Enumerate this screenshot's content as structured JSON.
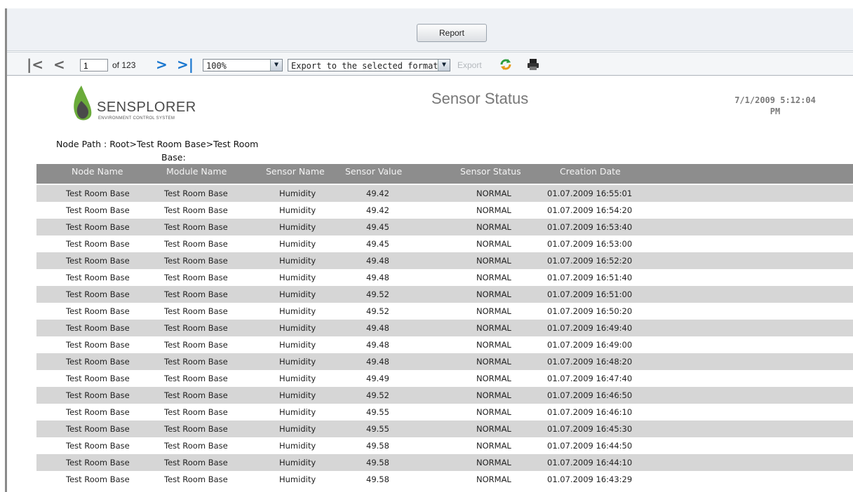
{
  "report_button": "Report",
  "toolbar": {
    "page_value": "1",
    "of_pages": "of 123",
    "zoom": "100%",
    "export_format": "Export to the selected format",
    "export_label": "Export"
  },
  "brand": {
    "name": "SENSPLORER",
    "tagline": "ENVIRONMENT CONTROL SYSTEM"
  },
  "report": {
    "title": "Sensor Status",
    "date_line1": "7/1/2009 5:12:04",
    "date_line2": "PM",
    "node_path_line1": "Node Path : Root>Test Room Base>Test Room",
    "node_path_line2": "Base:"
  },
  "table": {
    "headers": [
      "Node Name",
      "Module Name",
      "Sensor Name",
      "Sensor Value",
      "Sensor Status",
      "Creation Date"
    ],
    "rows": [
      [
        "Test Room Base",
        "Test Room Base",
        "Humidity",
        "49.42",
        "NORMAL",
        "01.07.2009 16:55:01"
      ],
      [
        "Test Room Base",
        "Test Room Base",
        "Humidity",
        "49.42",
        "NORMAL",
        "01.07.2009 16:54:20"
      ],
      [
        "Test Room Base",
        "Test Room Base",
        "Humidity",
        "49.45",
        "NORMAL",
        "01.07.2009 16:53:40"
      ],
      [
        "Test Room Base",
        "Test Room Base",
        "Humidity",
        "49.45",
        "NORMAL",
        "01.07.2009 16:53:00"
      ],
      [
        "Test Room Base",
        "Test Room Base",
        "Humidity",
        "49.48",
        "NORMAL",
        "01.07.2009 16:52:20"
      ],
      [
        "Test Room Base",
        "Test Room Base",
        "Humidity",
        "49.48",
        "NORMAL",
        "01.07.2009 16:51:40"
      ],
      [
        "Test Room Base",
        "Test Room Base",
        "Humidity",
        "49.52",
        "NORMAL",
        "01.07.2009 16:51:00"
      ],
      [
        "Test Room Base",
        "Test Room Base",
        "Humidity",
        "49.52",
        "NORMAL",
        "01.07.2009 16:50:20"
      ],
      [
        "Test Room Base",
        "Test Room Base",
        "Humidity",
        "49.48",
        "NORMAL",
        "01.07.2009 16:49:40"
      ],
      [
        "Test Room Base",
        "Test Room Base",
        "Humidity",
        "49.48",
        "NORMAL",
        "01.07.2009 16:49:00"
      ],
      [
        "Test Room Base",
        "Test Room Base",
        "Humidity",
        "49.48",
        "NORMAL",
        "01.07.2009 16:48:20"
      ],
      [
        "Test Room Base",
        "Test Room Base",
        "Humidity",
        "49.49",
        "NORMAL",
        "01.07.2009 16:47:40"
      ],
      [
        "Test Room Base",
        "Test Room Base",
        "Humidity",
        "49.52",
        "NORMAL",
        "01.07.2009 16:46:50"
      ],
      [
        "Test Room Base",
        "Test Room Base",
        "Humidity",
        "49.55",
        "NORMAL",
        "01.07.2009 16:46:10"
      ],
      [
        "Test Room Base",
        "Test Room Base",
        "Humidity",
        "49.55",
        "NORMAL",
        "01.07.2009 16:45:30"
      ],
      [
        "Test Room Base",
        "Test Room Base",
        "Humidity",
        "49.58",
        "NORMAL",
        "01.07.2009 16:44:50"
      ],
      [
        "Test Room Base",
        "Test Room Base",
        "Humidity",
        "49.58",
        "NORMAL",
        "01.07.2009 16:44:10"
      ],
      [
        "Test Room Base",
        "Test Room Base",
        "Humidity",
        "49.58",
        "NORMAL",
        "01.07.2009 16:43:29"
      ]
    ]
  },
  "colors": {
    "header_bg": "#8d8d8d",
    "alt_row": "#d6d6d6",
    "nav_active": "#1a77cf"
  }
}
